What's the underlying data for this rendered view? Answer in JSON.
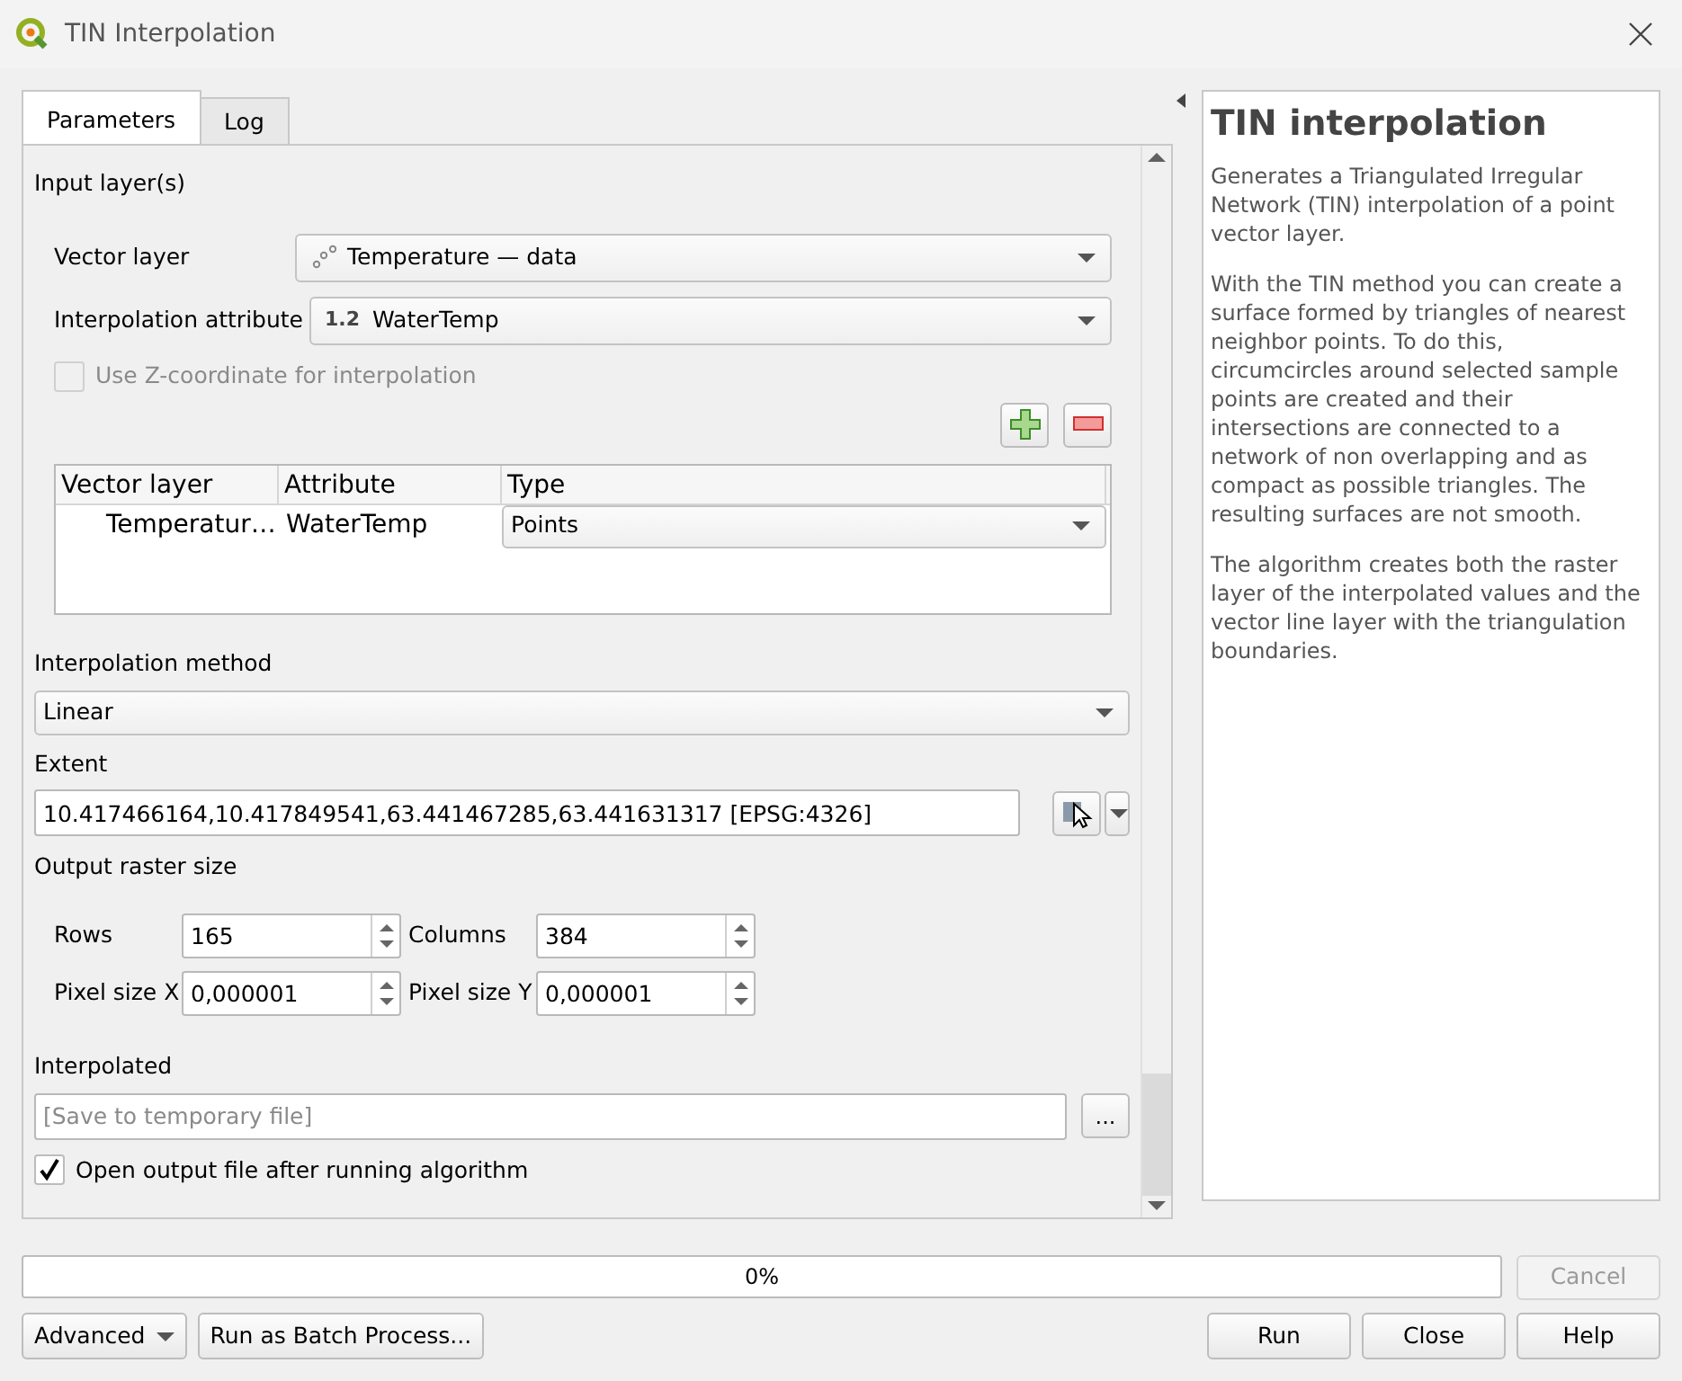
{
  "window": {
    "title": "TIN Interpolation"
  },
  "tabs": [
    {
      "label": "Parameters",
      "selected": true
    },
    {
      "label": "Log",
      "selected": false
    }
  ],
  "input_layers": {
    "heading": "Input layer(s)",
    "vector_layer": {
      "label": "Vector layer",
      "value": "Temperature — data"
    },
    "interpolation_attribute": {
      "label": "Interpolation attribute",
      "type_badge": "1.2",
      "value": "WaterTemp"
    },
    "use_z": {
      "label": "Use Z-coordinate for interpolation",
      "checked": false,
      "disabled": true
    },
    "table": {
      "columns": [
        "Vector layer",
        "Attribute",
        "Type"
      ],
      "rows": [
        {
          "layer": "Temperatur…",
          "attribute": "WaterTemp",
          "type": "Points"
        }
      ]
    }
  },
  "interpolation_method": {
    "label": "Interpolation method",
    "value": "Linear"
  },
  "extent": {
    "label": "Extent",
    "value": "10.417466164,10.417849541,63.441467285,63.441631317 [EPSG:4326]"
  },
  "output_raster_size": {
    "heading": "Output raster size",
    "fields": [
      {
        "label": "Rows",
        "value": "165"
      },
      {
        "label": "Columns",
        "value": "384"
      },
      {
        "label": "Pixel size X",
        "value": "0,000001"
      },
      {
        "label": "Pixel size Y",
        "value": "0,000001"
      }
    ]
  },
  "interpolated": {
    "label": "Interpolated",
    "placeholder": "[Save to temporary file]",
    "browse": "..."
  },
  "open_output": {
    "label": "Open output file after running algorithm",
    "checked": true
  },
  "help": {
    "title": "TIN interpolation",
    "paragraphs": [
      "Generates a Triangulated Irregular Network (TIN) interpolation of a point vector layer.",
      "With the TIN method you can create a surface formed by triangles of nearest neighbor points. To do this, circumcircles around selected sample points are created and their intersections are connected to a network of non overlapping and as compact as possible triangles. The resulting surfaces are not smooth.",
      "The algorithm creates both the raster layer of the interpolated values and the vector line layer with the triangulation boundaries."
    ]
  },
  "progress": {
    "level": 0,
    "reading": "0%"
  },
  "cancel": {
    "label": "Cancel",
    "disabled": true
  },
  "left_buttons": [
    {
      "label": "Advanced",
      "kind": "dropdown"
    },
    {
      "label": "Run as Batch Process...",
      "kind": "plain"
    }
  ],
  "right_buttons": [
    "Run",
    "Close",
    "Help"
  ]
}
